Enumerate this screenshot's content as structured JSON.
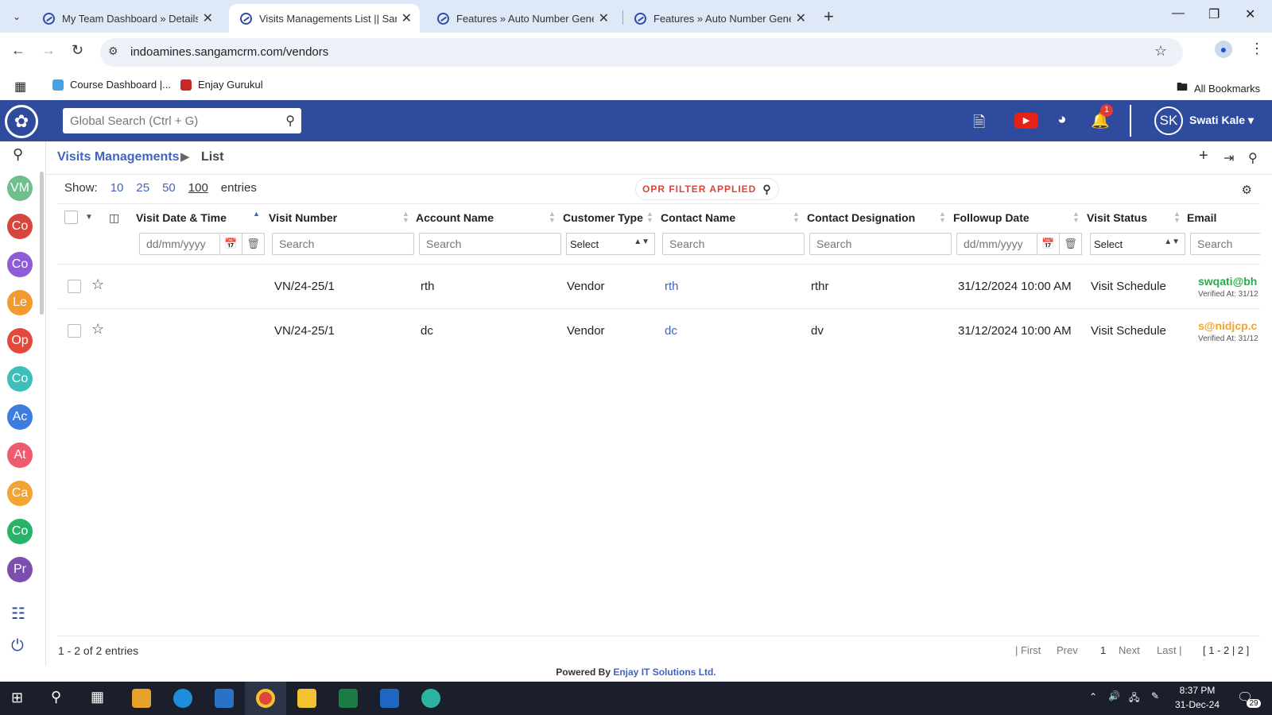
{
  "browser": {
    "tabs": [
      {
        "title": "My Team Dashboard » Details ||",
        "active": false
      },
      {
        "title": "Visits Managements List || Sang",
        "active": true
      },
      {
        "title": "Features » Auto Number Gener",
        "active": false
      },
      {
        "title": "Features » Auto Number Gener",
        "active": false
      }
    ],
    "url": "indoamines.sangamcrm.com/vendors",
    "bookmarks": [
      "Course Dashboard |...",
      "Enjay Gurukul"
    ],
    "all_bookmarks": "All Bookmarks"
  },
  "app": {
    "search_placeholder": "Global Search (Ctrl + G)",
    "notification_count": "1",
    "user_initials": "SK",
    "user_name": "Swati Kale"
  },
  "sidebar": {
    "items": [
      {
        "label": "VM",
        "color": "#6fbf8e"
      },
      {
        "label": "Co",
        "color": "#d9443b"
      },
      {
        "label": "Co",
        "color": "#8e5cd8"
      },
      {
        "label": "Le",
        "color": "#f29a2e"
      },
      {
        "label": "Op",
        "color": "#e5483b"
      },
      {
        "label": "Co",
        "color": "#3bbfb8"
      },
      {
        "label": "Ac",
        "color": "#3b7de0"
      },
      {
        "label": "At",
        "color": "#ef5a6e"
      },
      {
        "label": "Ca",
        "color": "#f2a532"
      },
      {
        "label": "Co",
        "color": "#27b36a"
      },
      {
        "label": "Pr",
        "color": "#7b4fb0"
      }
    ]
  },
  "breadcrumb": {
    "module": "Visits Managements",
    "page": "List"
  },
  "list": {
    "show_label": "Show:",
    "page_sizes": [
      "10",
      "25",
      "50",
      "100"
    ],
    "selected_page_size": "100",
    "entries_label": "entries",
    "filter_badge": "OPR FILTER APPLIED",
    "columns": [
      "Visit Date & Time",
      "Visit Number",
      "Account Name",
      "Customer Type",
      "Contact Name",
      "Contact Designation",
      "Followup Date",
      "Visit Status",
      "Email"
    ],
    "filters": {
      "date_placeholder": "dd/mm/yyyy",
      "search_placeholder": "Search",
      "select_label": "Select"
    },
    "rows": [
      {
        "visit_date": "",
        "visit_number": "VN/24-25/1",
        "account": "rth",
        "customer_type": "Vendor",
        "contact": "rth",
        "designation": "rthr",
        "followup": "31/12/2024 10:00 AM",
        "status": "Visit Schedule",
        "email": "swqati@bh",
        "verified": "Verified At: 31/12"
      },
      {
        "visit_date": "",
        "visit_number": "VN/24-25/1",
        "account": "dc",
        "customer_type": "Vendor",
        "contact": "dc",
        "designation": "dv",
        "followup": "31/12/2024 10:00 AM",
        "status": "Visit Schedule",
        "email": "s@nidjcp.c",
        "verified": "Verified At: 31/12"
      }
    ],
    "summary": "1 - 2 of 2 entries",
    "pagination": {
      "first": "| First",
      "prev": "Prev",
      "current": "1",
      "next": "Next",
      "last": "Last |",
      "range": "[ 1 - 2 | 2 ]"
    }
  },
  "footer": {
    "powered_by": "Powered By",
    "company": "Enjay IT Solutions Ltd."
  },
  "taskbar": {
    "time": "8:37 PM",
    "date": "31-Dec-24",
    "notifications": "29"
  }
}
